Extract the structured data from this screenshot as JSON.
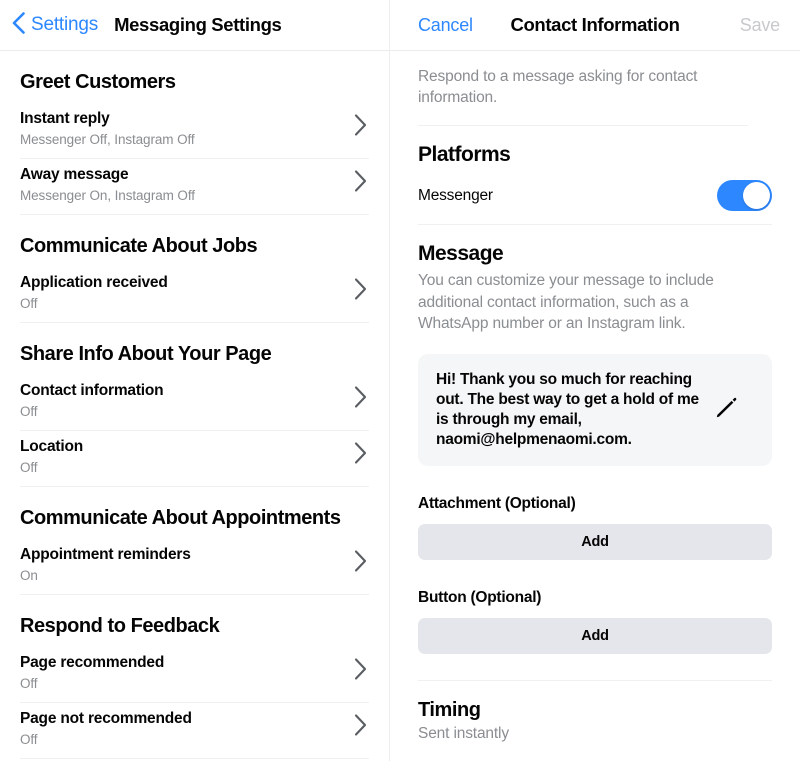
{
  "left": {
    "nav": {
      "back_icon": "chevron-left-icon",
      "back_label": "Settings",
      "title": "Messaging Settings"
    },
    "sections": [
      {
        "heading": "Greet Customers",
        "rows": [
          {
            "title": "Instant reply",
            "subtitle": "Messenger Off, Instagram Off",
            "chevron": "chevron-right-icon"
          },
          {
            "title": "Away message",
            "subtitle": "Messenger On, Instagram Off",
            "chevron": "chevron-right-icon"
          }
        ]
      },
      {
        "heading": "Communicate About Jobs",
        "rows": [
          {
            "title": "Application received",
            "subtitle": "Off",
            "chevron": "chevron-right-icon"
          }
        ]
      },
      {
        "heading": "Share Info About Your Page",
        "rows": [
          {
            "title": "Contact information",
            "subtitle": "Off",
            "chevron": "chevron-right-icon"
          },
          {
            "title": "Location",
            "subtitle": "Off",
            "chevron": "chevron-right-icon"
          }
        ]
      },
      {
        "heading": "Communicate About Appointments",
        "rows": [
          {
            "title": "Appointment reminders",
            "subtitle": "On",
            "chevron": "chevron-right-icon"
          }
        ]
      },
      {
        "heading": "Respond to Feedback",
        "rows": [
          {
            "title": "Page recommended",
            "subtitle": "Off",
            "chevron": "chevron-right-icon"
          },
          {
            "title": "Page not recommended",
            "subtitle": "Off",
            "chevron": "chevron-right-icon"
          }
        ]
      }
    ]
  },
  "right": {
    "nav": {
      "cancel_label": "Cancel",
      "title": "Contact Information",
      "save_label": "Save",
      "save_enabled": false
    },
    "intro": "Respond to a message asking for contact information.",
    "platforms": {
      "heading": "Platforms",
      "items": [
        {
          "label": "Messenger",
          "enabled": true
        }
      ]
    },
    "message": {
      "heading": "Message",
      "help": "You can customize your message to include additional contact information, such as a WhatsApp number or an Instagram link.",
      "body": "Hi! Thank you so much for reaching out. The best way to get a hold of me is through my email, naomi@helpmenaomi.com.",
      "edit_icon": "pencil-icon"
    },
    "attachment": {
      "label": "Attachment (Optional)",
      "add_label": "Add"
    },
    "button": {
      "label": "Button (Optional)",
      "add_label": "Add"
    },
    "timing": {
      "heading": "Timing",
      "value": "Sent instantly"
    }
  },
  "colors": {
    "accent_blue": "#2d88ff",
    "toggle_on": "#2d88ff",
    "text_primary": "#050505",
    "text_secondary": "#8a8d91",
    "button_gray": "#e4e6eb",
    "message_bg": "#f5f6f7",
    "save_disabled": "#c7c9cc"
  }
}
